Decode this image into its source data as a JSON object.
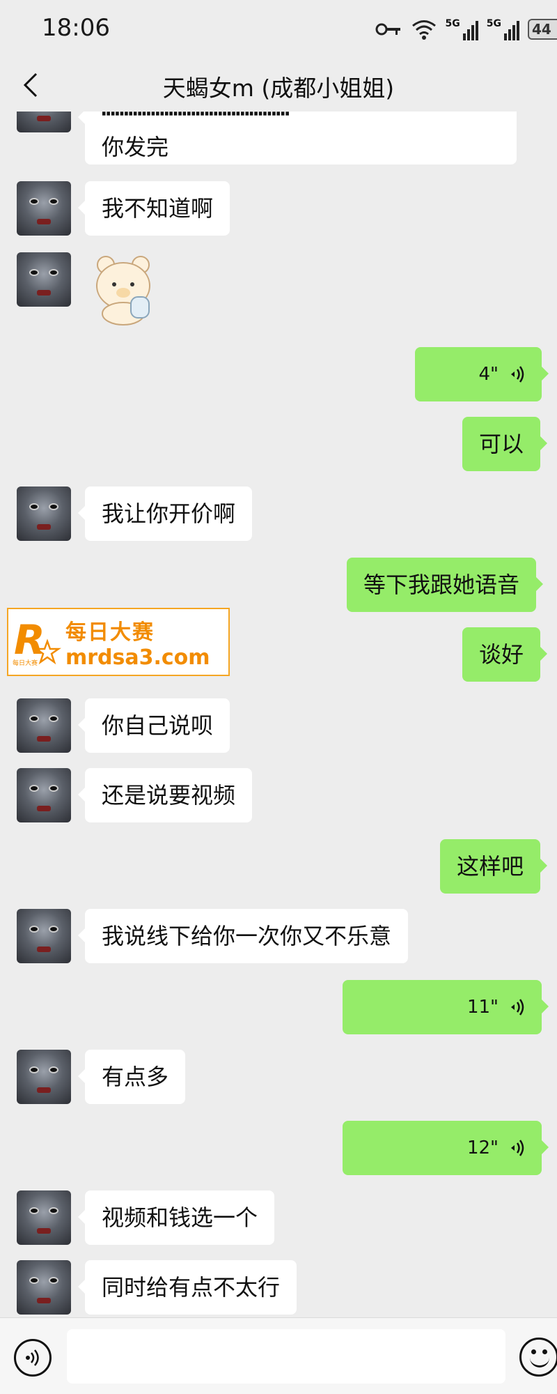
{
  "status_bar": {
    "time": "18:06",
    "battery": "44",
    "network_1": "5G",
    "network_2": "5G"
  },
  "header": {
    "title": "天蝎女m (成都小姐姐)"
  },
  "messages": [
    {
      "text": "你发完"
    },
    {
      "text": "我不知道啊"
    },
    {
      "sticker": "bear-sticker"
    },
    {
      "duration": "4\""
    },
    {
      "text": "可以"
    },
    {
      "text": "我让你开价啊"
    },
    {
      "text": "等下我跟她语音"
    },
    {
      "text": "谈好"
    },
    {
      "text": "你自己说呗"
    },
    {
      "text": "还是说要视频"
    },
    {
      "text": "这样吧"
    },
    {
      "text": "我说线下给你一次你又不乐意"
    },
    {
      "duration": "11\""
    },
    {
      "text": "有点多"
    },
    {
      "duration": "12\""
    },
    {
      "text": "视频和钱选一个"
    },
    {
      "text": "同时给有点不太行"
    }
  ],
  "watermark": {
    "line1": "每日大赛",
    "line2": "mrdsa3.com",
    "logo_letter": "R",
    "logo_small": "每日大赛"
  },
  "input_bar": {
    "placeholder": ""
  }
}
